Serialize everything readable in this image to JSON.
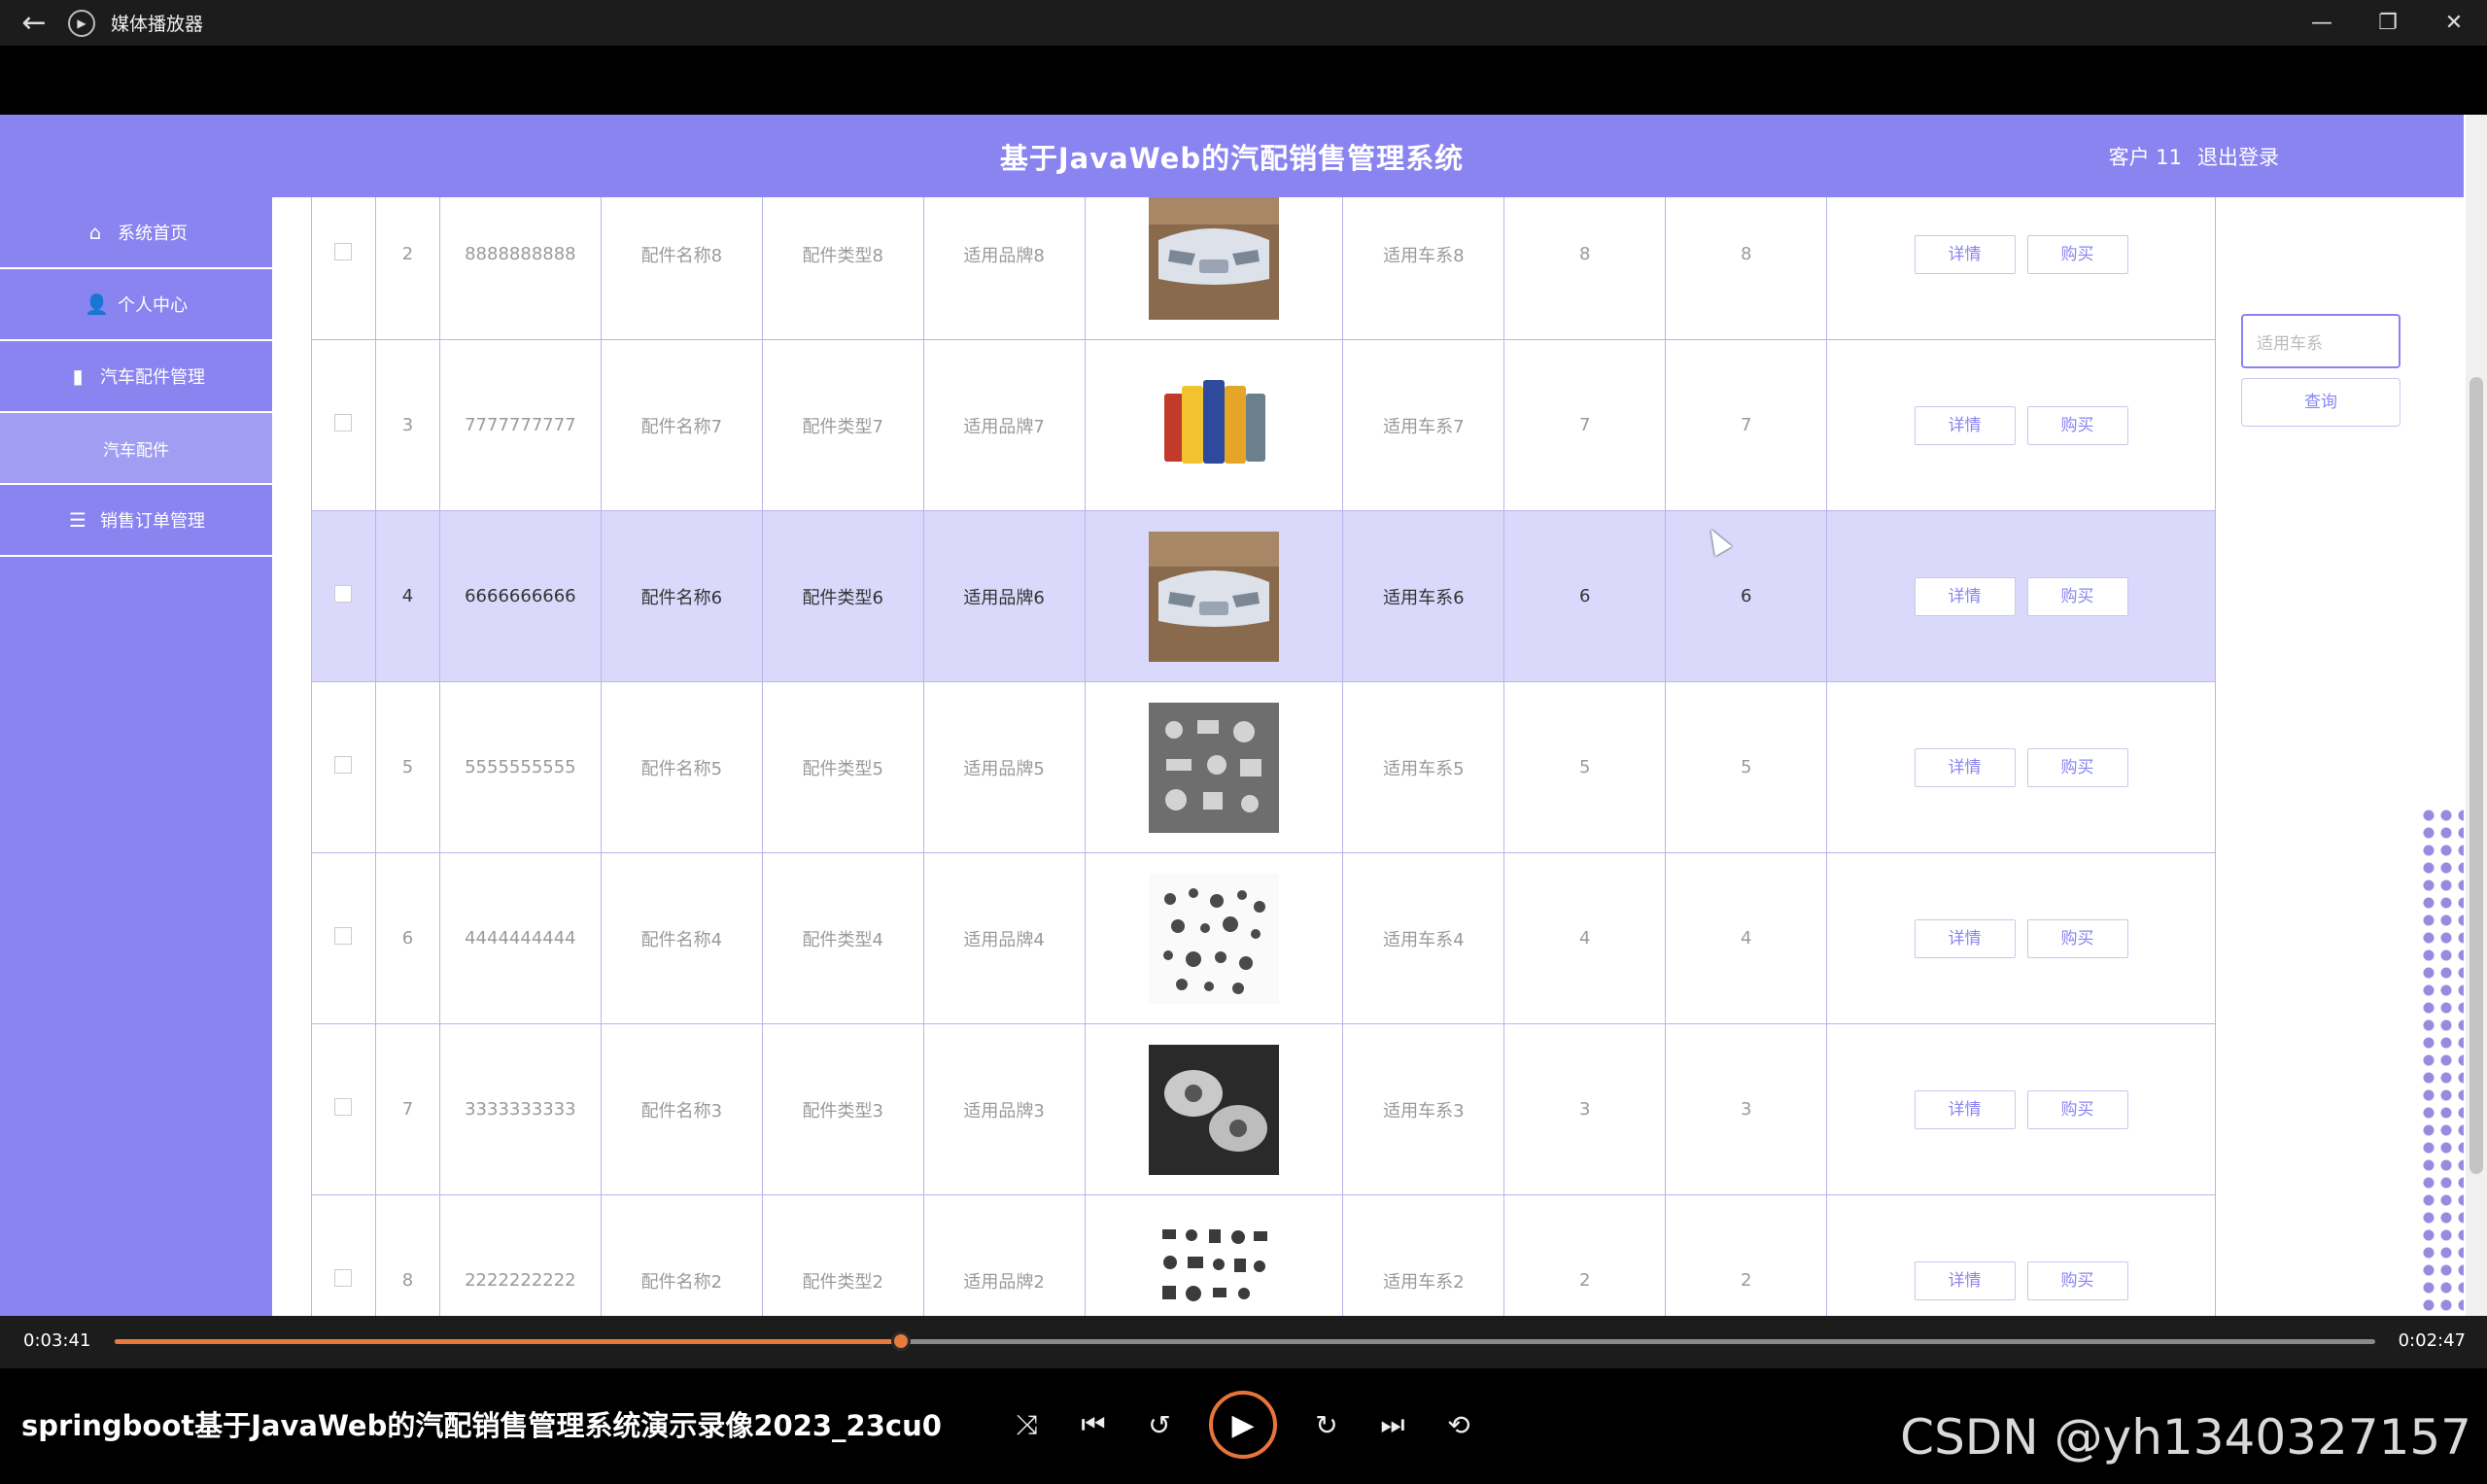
{
  "window": {
    "title": "媒体播放器",
    "back_glyph": "←",
    "min_glyph": "—",
    "restore_glyph": "❐",
    "close_glyph": "✕"
  },
  "app": {
    "title": "基于JavaWeb的汽配销售管理系统",
    "user": "客户 11",
    "logout": "退出登录"
  },
  "sidebar": {
    "items": [
      {
        "label": "系统首页",
        "icon": "⌂"
      },
      {
        "label": "个人中心",
        "icon": "👤"
      },
      {
        "label": "汽车配件管理",
        "icon": "▮"
      },
      {
        "label": "汽车配件",
        "icon": ""
      },
      {
        "label": "销售订单管理",
        "icon": "☰"
      }
    ]
  },
  "search": {
    "placeholder": "适用车系",
    "button": "查询"
  },
  "table": {
    "detail_label": "详情",
    "buy_label": "购买",
    "rows": [
      {
        "idx": "2",
        "code": "8888888888",
        "name": "配件名称8",
        "type": "配件类型8",
        "brand": "适用品牌8",
        "series": "适用车系8",
        "a": "8",
        "b": "8",
        "img": "bumper"
      },
      {
        "idx": "3",
        "code": "7777777777",
        "name": "配件名称7",
        "type": "配件类型7",
        "brand": "适用品牌7",
        "series": "适用车系7",
        "a": "7",
        "b": "7",
        "img": "oil"
      },
      {
        "idx": "4",
        "code": "6666666666",
        "name": "配件名称6",
        "type": "配件类型6",
        "brand": "适用品牌6",
        "series": "适用车系6",
        "a": "6",
        "b": "6",
        "img": "bumper"
      },
      {
        "idx": "5",
        "code": "5555555555",
        "name": "配件名称5",
        "type": "配件类型5",
        "brand": "适用品牌5",
        "series": "适用车系5",
        "a": "5",
        "b": "5",
        "img": "parts"
      },
      {
        "idx": "6",
        "code": "4444444444",
        "name": "配件名称4",
        "type": "配件类型4",
        "brand": "适用品牌4",
        "series": "适用车系4",
        "a": "4",
        "b": "4",
        "img": "bolts"
      },
      {
        "idx": "7",
        "code": "3333333333",
        "name": "配件名称3",
        "type": "配件类型3",
        "brand": "适用品牌3",
        "series": "适用车系3",
        "a": "3",
        "b": "3",
        "img": "casting"
      },
      {
        "idx": "8",
        "code": "2222222222",
        "name": "配件名称2",
        "type": "配件类型2",
        "brand": "适用品牌2",
        "series": "适用车系2",
        "a": "2",
        "b": "2",
        "img": "assortment"
      }
    ]
  },
  "player": {
    "current_time": "0:03:41",
    "remaining_time": "0:02:47",
    "progress": 0.348,
    "title": "springboot基于JavaWeb的汽配销售管理系统演示录像2023_23cu0",
    "watermark": "CSDN @yh1340327157",
    "shuffle": "⤨",
    "prev": "⏮",
    "back10": "↺",
    "play": "▶",
    "fwd30": "↻",
    "next": "⏭",
    "repeat": "⟲",
    "colors": {
      "accent": "#e87a3c"
    }
  },
  "colors": {
    "primary": "#8a84f0",
    "highlight_row": "#dad8fb"
  }
}
